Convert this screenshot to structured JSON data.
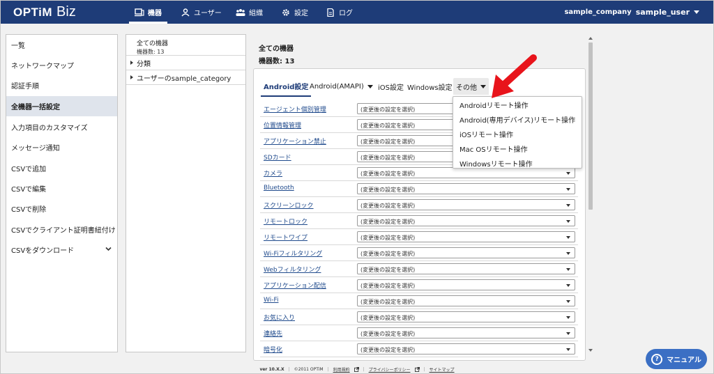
{
  "header": {
    "logo_optim": "OPTiM",
    "logo_biz": "Biz",
    "tabs": [
      {
        "label": "機器",
        "icon": "device-icon"
      },
      {
        "label": "ユーザー",
        "icon": "user-icon"
      },
      {
        "label": "組織",
        "icon": "organization-icon"
      },
      {
        "label": "設定",
        "icon": "gear-icon"
      },
      {
        "label": "ログ",
        "icon": "log-icon"
      }
    ],
    "company": "sample_company",
    "user": "sample_user"
  },
  "sidebar": {
    "items": [
      {
        "label": "一覧"
      },
      {
        "label": "ネットワークマップ"
      },
      {
        "label": "認証手順"
      },
      {
        "label": "全機器一括設定"
      },
      {
        "label": "入力項目のカスタマイズ"
      },
      {
        "label": "メッセージ通知"
      },
      {
        "label": "CSVで追加"
      },
      {
        "label": "CSVで編集"
      },
      {
        "label": "CSVで削除"
      },
      {
        "label": "CSVでクライアント証明書紐付け"
      },
      {
        "label": "CSVをダウンロード"
      }
    ]
  },
  "tree": {
    "title": "全ての機器",
    "count": "機器数: 13",
    "nodes": [
      {
        "label": "分類"
      },
      {
        "label": "ユーザーのsample_category"
      }
    ]
  },
  "main": {
    "title": "全ての機器",
    "count": "機器数: 13",
    "tabs": [
      {
        "label": "Android設定"
      },
      {
        "label": "Android(AMAPI)"
      },
      {
        "label": "iOS設定"
      },
      {
        "label": "Windows設定"
      },
      {
        "label": "その他"
      }
    ],
    "select_placeholder": "(変更後の設定を選択)",
    "rows": [
      {
        "label": "エージェント個別管理"
      },
      {
        "label": "位置情報管理"
      },
      {
        "label": "アプリケーション禁止"
      },
      {
        "label": "SDカード"
      },
      {
        "label": "カメラ"
      },
      {
        "label": "Bluetooth"
      },
      {
        "label": "スクリーンロック"
      },
      {
        "label": "リモートロック"
      },
      {
        "label": "リモートワイプ"
      },
      {
        "label": "Wi-Fiフィルタリング"
      },
      {
        "label": "Webフィルタリング"
      },
      {
        "label": "アプリケーション配信"
      },
      {
        "label": "Wi-Fi"
      },
      {
        "label": "お気に入り"
      },
      {
        "label": "連絡先"
      },
      {
        "label": "暗号化"
      }
    ]
  },
  "menu": {
    "items": [
      {
        "label": "Androidリモート操作"
      },
      {
        "label": "Android(専用デバイス)リモート操作"
      },
      {
        "label": "iOSリモート操作"
      },
      {
        "label": "Mac OSリモート操作"
      },
      {
        "label": "Windowsリモート操作"
      }
    ]
  },
  "footer": {
    "version": "ver 10.X.X",
    "copyright": "©2011 OPTiM",
    "terms": "利用規約",
    "privacy": "プライバシーポリシー",
    "sitemap": "サイトマップ"
  },
  "manual_button": "マニュアル",
  "colors": {
    "header_bg": "#1e3c78",
    "accent": "#1e3c78",
    "arrow": "#e8141b",
    "manual_btn": "#3b6fc4"
  }
}
